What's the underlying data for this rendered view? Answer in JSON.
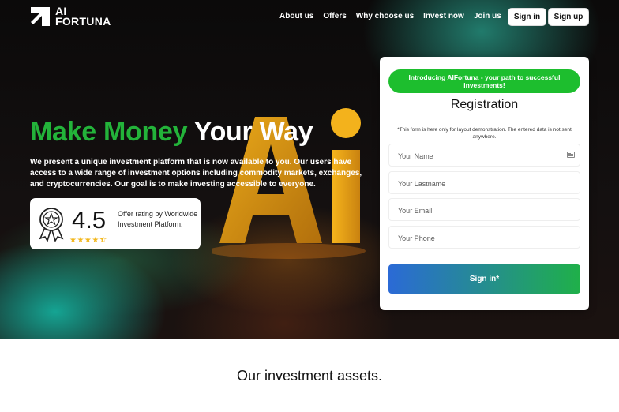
{
  "logo": {
    "line1": "AI",
    "line2": "FORTUNA"
  },
  "nav": {
    "items": [
      "About us",
      "Offers",
      "Why choose us",
      "Invest now",
      "Join us"
    ]
  },
  "header_buttons": {
    "sign_in": "Sign in",
    "sign_up": "Sign up"
  },
  "hero": {
    "headline_green": "Make Money",
    "headline_white": "Your Way",
    "description": "We present a unique investment platform that is now available to you. Our users have access to a wide range of investment options including commodity markets, exchanges, and cryptocurrencies. Our goal is to make investing accessible to everyone."
  },
  "rating": {
    "value": "4.5",
    "stars": "★★★★⯪",
    "text": "Offer rating by Worldwide Investment Platform."
  },
  "registration": {
    "intro": "Introducing AIFortuna - your path to successful investments!",
    "title": "Registration",
    "note": "*This form is here only for layout demonstration. The entered data is not sent anywhere.",
    "fields": {
      "name": "Your Name",
      "lastname": "Your Lastname",
      "email": "Your Email",
      "phone": "Your Phone"
    },
    "submit": "Sign in*"
  },
  "assets": {
    "title": "Our investment assets."
  },
  "colors": {
    "accent_green": "#23b33a",
    "button_gradient_start": "#2b6ad6",
    "button_gradient_end": "#1fb049"
  },
  "icons": [
    "logo-mark-icon",
    "award-badge-icon",
    "contact-card-icon"
  ]
}
